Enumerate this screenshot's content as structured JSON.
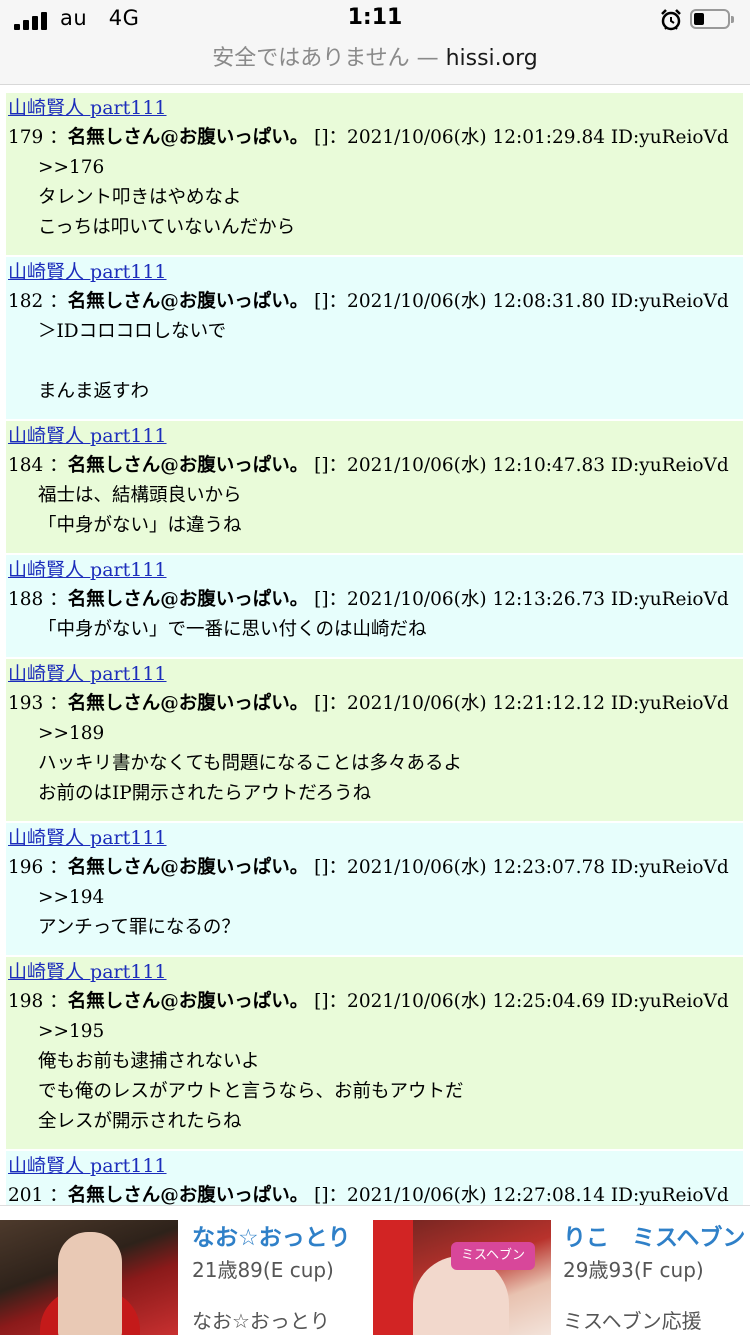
{
  "status_bar": {
    "carrier": "au",
    "network": "4G",
    "time": "1:11"
  },
  "url_bar": {
    "warning": "安全ではありません",
    "separator": "—",
    "host": "hissi.org"
  },
  "posts": [
    {
      "thread": "山崎賢人 part111",
      "number": "179",
      "name": "名無しさん@お腹いっぱい。",
      "meta": "[]：2021/10/06(水) 12:01:29.84 ID:yuReioVd",
      "lines": [
        ">>176",
        "タレント叩きはやめなよ",
        "こっちは叩いていないんだから"
      ],
      "color": "green"
    },
    {
      "thread": "山崎賢人 part111",
      "number": "182",
      "name": "名無しさん@お腹いっぱい。",
      "meta": "[]：2021/10/06(水) 12:08:31.80 ID:yuReioVd",
      "lines": [
        "＞IDコロコロしないで",
        "",
        "まんま返すわ"
      ],
      "color": "blue"
    },
    {
      "thread": "山崎賢人 part111",
      "number": "184",
      "name": "名無しさん@お腹いっぱい。",
      "meta": "[]：2021/10/06(水) 12:10:47.83 ID:yuReioVd",
      "lines": [
        "福士は、結構頭良いから",
        "「中身がない」は違うね"
      ],
      "color": "green"
    },
    {
      "thread": "山崎賢人 part111",
      "number": "188",
      "name": "名無しさん@お腹いっぱい。",
      "meta": "[]：2021/10/06(水) 12:13:26.73 ID:yuReioVd",
      "lines": [
        "「中身がない」で一番に思い付くのは山崎だね"
      ],
      "color": "blue"
    },
    {
      "thread": "山崎賢人 part111",
      "number": "193",
      "name": "名無しさん@お腹いっぱい。",
      "meta": "[]：2021/10/06(水) 12:21:12.12 ID:yuReioVd",
      "lines": [
        ">>189",
        "ハッキリ書かなくても問題になることは多々あるよ",
        "お前のはIP開示されたらアウトだろうね"
      ],
      "color": "green"
    },
    {
      "thread": "山崎賢人 part111",
      "number": "196",
      "name": "名無しさん@お腹いっぱい。",
      "meta": "[]：2021/10/06(水) 12:23:07.78 ID:yuReioVd",
      "lines": [
        ">>194",
        "アンチって罪になるの？"
      ],
      "color": "blue"
    },
    {
      "thread": "山崎賢人 part111",
      "number": "198",
      "name": "名無しさん@お腹いっぱい。",
      "meta": "[]：2021/10/06(水) 12:25:04.69 ID:yuReioVd",
      "lines": [
        ">>195",
        "俺もお前も逮捕されないよ",
        "でも俺のレスがアウトと言うなら、お前もアウトだ",
        "全レスが開示されたらね"
      ],
      "color": "green"
    },
    {
      "thread": "山崎賢人 part111",
      "number": "201",
      "name": "名無しさん@お腹いっぱい。",
      "meta": "[]：2021/10/06(水) 12:27:08.14 ID:yuReioVd",
      "lines": [],
      "color": "blue"
    }
  ],
  "ad": {
    "left": {
      "title": "なお☆おっとり",
      "age": "21歳89(E cup)",
      "sub": "なお☆おっとり"
    },
    "right": {
      "title": "りこ　ミスヘブン",
      "age": "29歳93(F cup)",
      "sub": "ミスヘブン応援",
      "stamp": "ミスヘブン"
    }
  }
}
